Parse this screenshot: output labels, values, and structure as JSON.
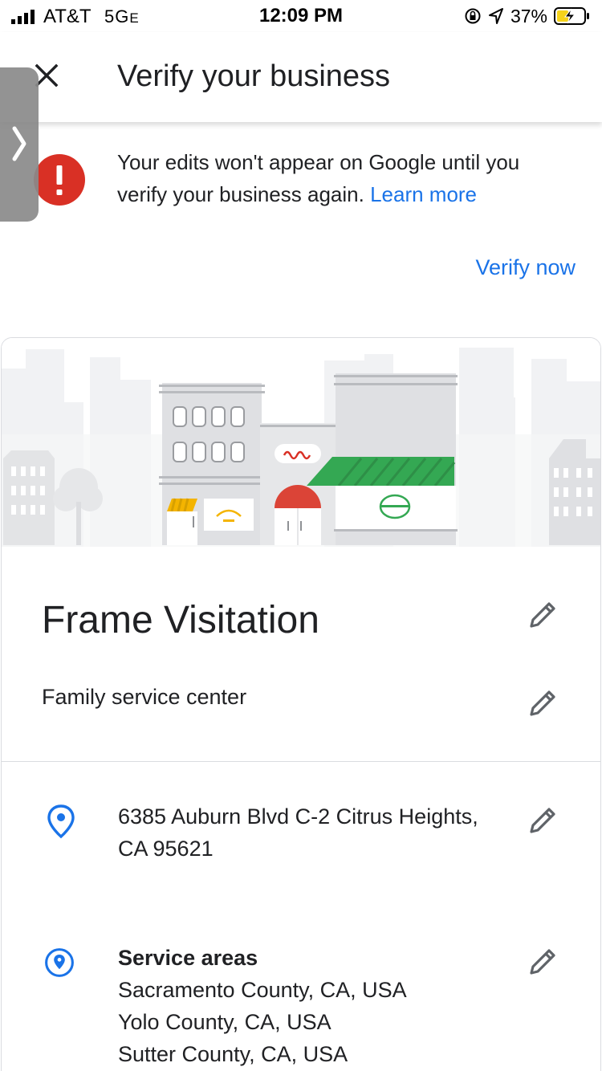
{
  "status_bar": {
    "carrier": "AT&T",
    "network": "5G",
    "network_suffix": "E",
    "time": "12:09 PM",
    "battery": "37%"
  },
  "app_bar": {
    "title": "Verify your business",
    "close_icon": "close-icon"
  },
  "banner": {
    "message": "Your edits won't appear on Google until you verify your business again.",
    "link": "Learn more",
    "action": "Verify now",
    "icon": "alert-icon",
    "icon_color": "#d93025"
  },
  "business": {
    "name": "Frame Visitation",
    "category": "Family service center",
    "address": "6385 Auburn Blvd C-2 Citrus Heights, CA 95621",
    "service_areas": {
      "title": "Service areas",
      "items": [
        "Sacramento County, CA, USA",
        "Yolo County, CA, USA",
        "Sutter County, CA, USA"
      ]
    }
  },
  "colors": {
    "accent": "#1a73e8",
    "alert": "#d93025",
    "text": "#202124"
  }
}
